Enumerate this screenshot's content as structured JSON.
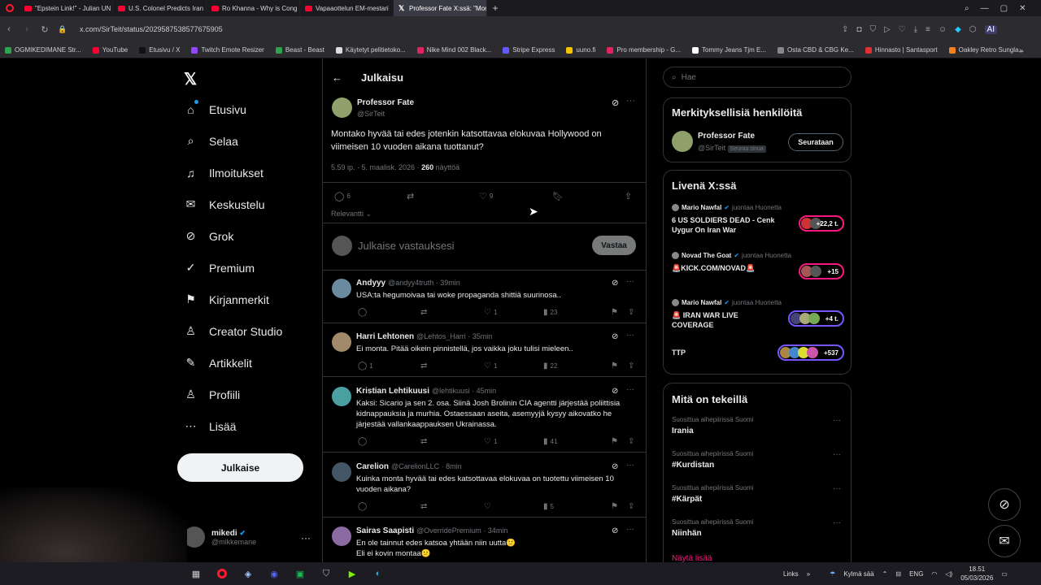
{
  "browser": {
    "tabs": [
      {
        "title": "\"Epstein Link!\" - Julian UN",
        "icon": "youtube-icon"
      },
      {
        "title": "U.S. Colonel Predicts Iran",
        "icon": "youtube-icon"
      },
      {
        "title": "Ro Khanna - Why is Cong",
        "icon": "youtube-icon"
      },
      {
        "title": "Vapaaottelun EM-mestari",
        "icon": "youtube-icon"
      },
      {
        "title": "Professor Fate X:ssä: \"Mon",
        "icon": "x-icon"
      }
    ],
    "url": "x.com/SirTeit/status/2029587538577675905",
    "bookmarks": [
      {
        "label": "OGMIKEDIMANE Str...",
        "color": "#2ea44f"
      },
      {
        "label": "YouTube",
        "color": "#ff0033"
      },
      {
        "label": "Etusivu / X",
        "color": "#111111"
      },
      {
        "label": "Twitch Emote Resizer",
        "color": "#9146ff"
      },
      {
        "label": "Beast - Beast",
        "color": "#2ea44f"
      },
      {
        "label": "Käytetyt pelitietoko...",
        "color": "#dddddd"
      },
      {
        "label": "Nike Mind 002 Black...",
        "color": "#e0245e"
      },
      {
        "label": "Stripe Express",
        "color": "#635bff"
      },
      {
        "label": "uuno.fi",
        "color": "#f5c400"
      },
      {
        "label": "Pro membership - G...",
        "color": "#e0245e"
      },
      {
        "label": "Tommy Jeans Tjm E...",
        "color": "#ffffff"
      },
      {
        "label": "Osta CBD & CBG Ke...",
        "color": "#888888"
      },
      {
        "label": "Hinnasto | Santasport",
        "color": "#e03030"
      },
      {
        "label": "Oakley Retro Sungla...",
        "color": "#f58220"
      }
    ]
  },
  "leftnav": {
    "items": [
      {
        "label": "Etusivu",
        "icon": "home-icon"
      },
      {
        "label": "Selaa",
        "icon": "search-icon"
      },
      {
        "label": "Ilmoitukset",
        "icon": "bell-icon"
      },
      {
        "label": "Keskustelu",
        "icon": "envelope-icon"
      },
      {
        "label": "Grok",
        "icon": "grok-icon"
      },
      {
        "label": "Premium",
        "icon": "premium-icon"
      },
      {
        "label": "Kirjanmerkit",
        "icon": "bookmark-icon"
      },
      {
        "label": "Creator Studio",
        "icon": "creator-studio-icon"
      },
      {
        "label": "Artikkelit",
        "icon": "articles-icon"
      },
      {
        "label": "Profiili",
        "icon": "profile-icon"
      },
      {
        "label": "Lisää",
        "icon": "more-circle-icon"
      }
    ],
    "publish_label": "Julkaise",
    "account": {
      "name": "mikedi",
      "handle": "@mikkemane"
    }
  },
  "header": {
    "title": "Julkaisu"
  },
  "post": {
    "author": "Professor Fate",
    "handle": "@SirTeit",
    "text_line1": "Montako hyvää tai edes jotenkin katsottavaa elokuvaa Hollywood on",
    "text_line2": "viimeisen 10 vuoden aikana tuottanut?",
    "timestamp": "5.59 ip. · 5. maalisk. 2026 ·",
    "views_count": "260",
    "views_label": "näyttöä",
    "replies": "6",
    "likes": "9",
    "sort_label": "Relevantti"
  },
  "composer": {
    "placeholder": "Julkaise vastauksesi",
    "reply_button": "Vastaa"
  },
  "replies": [
    {
      "name": "Andyyy",
      "handle": "@andyy4truth · 39min",
      "lines": [
        "USA:ta hegumoivaa tai woke propaganda shittiä suurinosa.."
      ],
      "replies": "",
      "likes": "1",
      "views": "23"
    },
    {
      "name": "Harri Lehtonen",
      "handle": "@Lehtos_Harri · 35min",
      "lines": [
        "Ei monta. Pitää oikein pinnistellä, jos vaikka joku tulisi mieleen.."
      ],
      "replies": "1",
      "likes": "1",
      "views": "22"
    },
    {
      "name": "Kristian Lehtikuusi",
      "handle": "@lehtikuusi · 45min",
      "lines": [
        "Kaksi: Sicario ja sen 2. osa. Siinä Josh Brolinin CIA agentti järjestää poliittisia",
        "kidnappauksia ja murhia. Ostaessaan aseita, asemyyjä kysyy aikovatko he",
        "järjestää vallankaappauksen Ukrainassa."
      ],
      "replies": "",
      "likes": "1",
      "views": "41"
    },
    {
      "name": "Carelion",
      "handle": "@CarelionLLC · 8min",
      "lines": [
        "Kuinka monta hyvää tai edes katsottavaa elokuvaa on tuotettu viimeisen 10",
        "vuoden aikana?"
      ],
      "replies": "",
      "likes": "",
      "views": "5"
    },
    {
      "name": "Sairas Saapisti",
      "handle": "@OverridePremium · 34min",
      "lines": [
        "En ole tainnut edes katsoa yhtään niin uutta🙂",
        "Eli ei kovin montaa😕"
      ],
      "replies": "",
      "likes": "",
      "views": ""
    }
  ],
  "right": {
    "search_placeholder": "Hae",
    "relevant": {
      "title": "Merkityksellisiä henkilöitä",
      "name": "Professor Fate",
      "handle": "@SirTeit",
      "follows_you": "Seuraa sinua",
      "follow_button": "Seurataan"
    },
    "live": {
      "title": "Livenä X:ssä",
      "items": [
        {
          "host": "Mario Nawfal",
          "status": "juontaa Huonetta",
          "title_lines": [
            "6 US SOLDIERS DEAD - Cenk",
            "Uygur On Iran War"
          ],
          "count": "+22,2 t."
        },
        {
          "host": "Novad The Goat",
          "status": "juontaa Huonetta",
          "title_lines": [
            "🚨KICK.COM/NOVAD🚨"
          ],
          "count": "+15"
        },
        {
          "host": "Mario Nawfal",
          "status": "juontaa Huonetta",
          "title_lines": [
            "🚨 IRAN WAR LIVE",
            "COVERAGE"
          ],
          "count": "+4 t."
        },
        {
          "host": "",
          "status": "",
          "title_lines": [
            "TTP"
          ],
          "count": "+537"
        }
      ]
    },
    "trends": {
      "title": "Mitä on tekeillä",
      "items": [
        {
          "context": "Suosittua aihepiirissä Suomi",
          "name": "Irania"
        },
        {
          "context": "Suosittua aihepiirissä Suomi",
          "name": "#Kurdistan"
        },
        {
          "context": "Suosittua aihepiirissä Suomi",
          "name": "#Kärpät"
        },
        {
          "context": "Suosittua aihepiirissä Suomi",
          "name": "Niinhän"
        }
      ],
      "show_more": "Näytä lisää"
    }
  },
  "taskbar": {
    "links": "Links",
    "weather": "Kylmä sää",
    "lang": "ENG",
    "time": "18.51",
    "date": "05/03/2026"
  }
}
